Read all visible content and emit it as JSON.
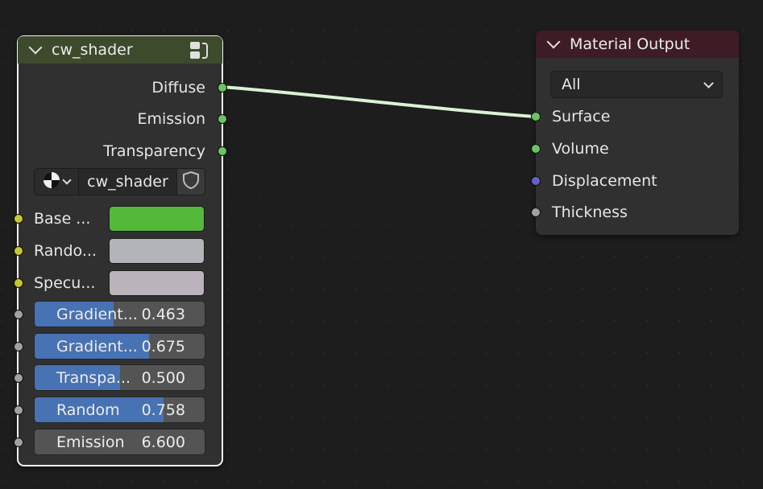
{
  "colors": {
    "shader_header": "#3d4a2c",
    "output_header": "#3e1c25",
    "link": "#d9f2d4",
    "base_color_swatch": "#54b93b",
    "random_color_swatch": "#b2b4b9",
    "specular_color_swatch": "#bbb3bb"
  },
  "shader_node": {
    "title": "cw_shader",
    "header_icon": "node-group-icon",
    "outputs": [
      {
        "label": "Diffuse",
        "socket": "green"
      },
      {
        "label": "Emission",
        "socket": "green"
      },
      {
        "label": "Transparency",
        "socket": "green"
      }
    ],
    "group_field": {
      "type_icon": "node-tree-icon",
      "name": "cw_shader",
      "fake_user_icon": "shield-icon"
    },
    "color_inputs": [
      {
        "label": "Base ...",
        "color": "#54b93b"
      },
      {
        "label": "Rando...",
        "color": "#b2b4b9"
      },
      {
        "label": "Specu...",
        "color": "#bbb3bb"
      }
    ],
    "value_inputs": [
      {
        "label": "Gradient...",
        "value": "0.463",
        "fill": 0.463
      },
      {
        "label": "Gradient...",
        "value": "0.675",
        "fill": 0.675
      },
      {
        "label": "Transpa...",
        "value": "0.500",
        "fill": 0.5
      },
      {
        "label": "Random",
        "value": "0.758",
        "fill": 0.758
      },
      {
        "label": "Emission",
        "value": "6.600",
        "fill": 0
      }
    ]
  },
  "output_node": {
    "title": "Material Output",
    "target": "All",
    "inputs": [
      {
        "label": "Surface",
        "socket": "green"
      },
      {
        "label": "Volume",
        "socket": "green"
      },
      {
        "label": "Displacement",
        "socket": "blue"
      },
      {
        "label": "Thickness",
        "socket": "gray"
      }
    ]
  }
}
